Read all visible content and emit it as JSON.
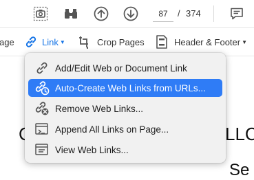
{
  "toolbar_top": {
    "icons": [
      "screenshot-icon",
      "binoculars-icon",
      "page-up-icon",
      "page-down-icon",
      "comment-icon"
    ],
    "page_current": "87",
    "page_separator": "/",
    "page_total": "374"
  },
  "toolbar_edit": {
    "partial_label": "age",
    "link_label": "Link",
    "crop_label": "Crop Pages",
    "header_footer_label": "Header & Footer"
  },
  "document": {
    "text_left": "C",
    "text_right": "LLC",
    "text_bottom": "Se"
  },
  "link_menu": {
    "items": [
      {
        "label": "Add/Edit Web or Document Link",
        "icon": "link-edit-icon",
        "selected": false
      },
      {
        "label": "Auto-Create Web Links from URLs...",
        "icon": "link-auto-icon",
        "selected": true
      },
      {
        "label": "Remove Web Links...",
        "icon": "link-remove-icon",
        "selected": false
      },
      {
        "label": "Append All Links on Page...",
        "icon": "append-links-icon",
        "selected": false
      },
      {
        "label": "View Web Links...",
        "icon": "view-links-icon",
        "selected": false
      }
    ]
  },
  "colors": {
    "accent": "#1473e6",
    "menu_highlight": "#2f7cf6",
    "menu_background": "#f1f1f1"
  }
}
